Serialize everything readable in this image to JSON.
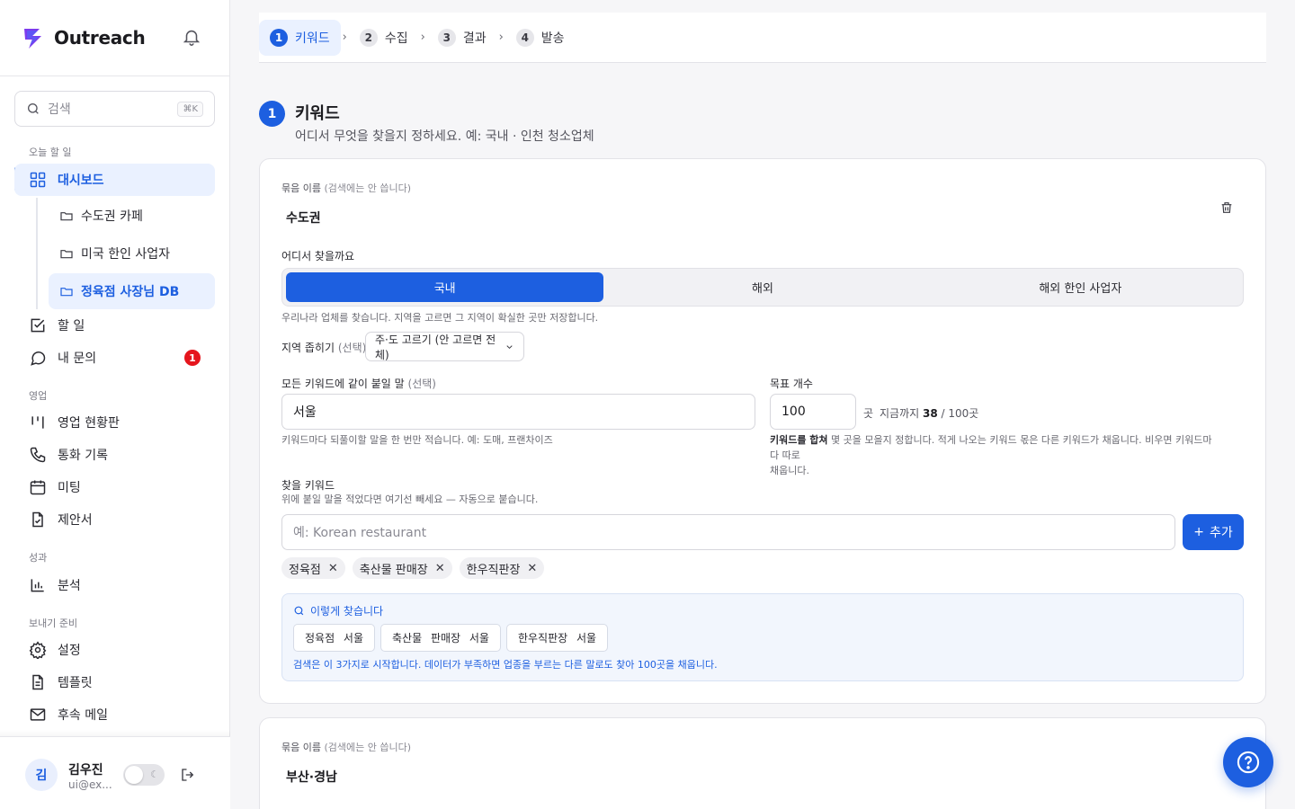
{
  "brand": {
    "name": "Outreach",
    "color": "#1d5fe0"
  },
  "search": {
    "placeholder": "검색",
    "shortcut": "⌘K"
  },
  "sidebar": {
    "sections": [
      "오늘 할 일",
      "영업",
      "성과",
      "보내기 준비"
    ],
    "dashboard": "대시보드",
    "sub_items": [
      "수도권 카페",
      "미국 한인 사업자",
      "정육점 사장님 DB"
    ],
    "todo": "할 일",
    "inquiry": "내 문의",
    "inquiry_badge": "1",
    "sales": [
      "영업 현황판",
      "통화 기록",
      "미팅",
      "제안서"
    ],
    "perf": [
      "분석"
    ],
    "prep": [
      "설정",
      "템플릿",
      "후속 메일"
    ]
  },
  "user": {
    "initial": "김",
    "name": "김우진",
    "email": "ui@ex..."
  },
  "steps": [
    {
      "num": "1",
      "label": "키워드"
    },
    {
      "num": "2",
      "label": "수집"
    },
    {
      "num": "3",
      "label": "결과"
    },
    {
      "num": "4",
      "label": "발송"
    }
  ],
  "section": {
    "num": "1",
    "title": "키워드",
    "desc": "어디서 무엇을 찾을지 정하세요. 예: 국내 · 인천 청소업체"
  },
  "card1": {
    "group_label": "묶음 이름",
    "group_label_note": "(검색에는 안 씁니다)",
    "group_name": "수도권",
    "where_label": "어디서 찾을까요",
    "where_options": [
      "국내",
      "해외",
      "해외 한인 사업자"
    ],
    "where_hint": "우리나라 업체를 찾습니다. 지역을 고르면 그 지역이 확실한 곳만 저장합니다.",
    "region_label": "지역 좁히기",
    "region_label_note": "(선택)",
    "region_select": "주·도 고르기 (안 고르면 전체)",
    "common_label": "모든 키워드에 같이 붙일 말",
    "common_label_note": "(선택)",
    "common_value": "서울",
    "common_hint": "키워드마다 되풀이할 말을 한 번만 적습니다. 예: 도매, 프랜차이즈",
    "target_label": "목표 개수",
    "target_value": "100",
    "target_unit": "곳",
    "target_progress_prefix": "지금까지",
    "target_progress_count": "38",
    "target_progress_total": "/ 100곳",
    "target_hint_bold": "키워드를 합쳐",
    "target_hint_1": " 몇 곳을 모을지 정합니다. 적게 나오는 키워드 몫은 다른 키워드가 채웁니다. 비우면 키워드마다 따로",
    "target_hint_2": "채웁니다.",
    "kw_label": "찾을 키워드",
    "kw_hint": "위에 붙일 말을 적었다면 여기선 빼세요 — 자동으로 붙습니다.",
    "kw_placeholder": "예: Korean restaurant",
    "add_label": "추가",
    "chips": [
      "정육점",
      "축산물 판매장",
      "한우직판장"
    ],
    "preview_title": "이렇게 찾습니다",
    "preview_tags": [
      "정육점 서울",
      "축산물 판매장 서울",
      "한우직판장 서울"
    ],
    "preview_note": "검색은 이 3가지로 시작합니다. 데이터가 부족하면 업종을 부르는 다른 말로도 찾아 100곳을 채웁니다."
  },
  "card2": {
    "group_label": "묶음 이름",
    "group_label_note": "(검색에는 안 씁니다)",
    "group_name": "부산·경남"
  }
}
